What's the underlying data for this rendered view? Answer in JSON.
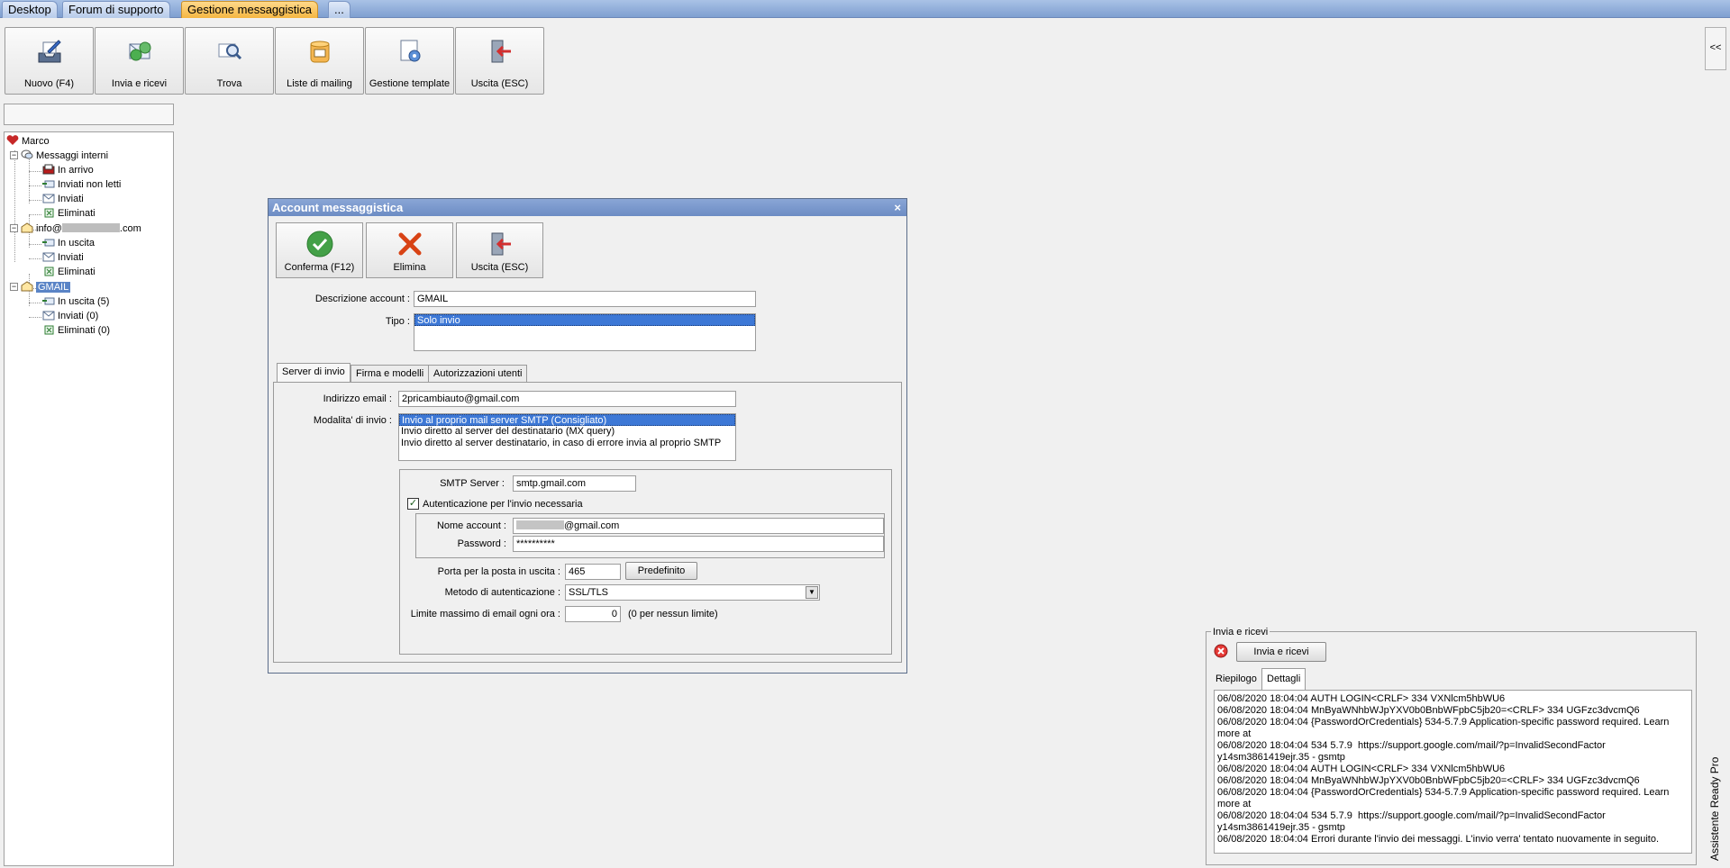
{
  "top_tabs": [
    {
      "label": "Desktop",
      "active": false
    },
    {
      "label": "Forum di supporto",
      "active": false
    },
    {
      "label": "Gestione messaggistica",
      "active": true
    },
    {
      "label": "...",
      "active": false
    }
  ],
  "toolbar": {
    "buttons": [
      {
        "label": "Nuovo (F4)",
        "icon": "new-message-icon"
      },
      {
        "label": "Invia e ricevi",
        "icon": "send-receive-icon"
      },
      {
        "label": "Trova",
        "icon": "find-icon"
      },
      {
        "label": "Liste di mailing",
        "icon": "mailing-list-icon"
      },
      {
        "label": "Gestione template",
        "icon": "template-icon"
      },
      {
        "label": "Uscita (ESC)",
        "icon": "exit-icon"
      }
    ]
  },
  "collapse_label": "<<",
  "side_panel_label": "Assistente Ready Pro",
  "tree": {
    "root": "Marco",
    "internal": {
      "label": "Messaggi interni",
      "children": [
        "In arrivo",
        "Inviati non letti",
        "Inviati",
        "Eliminati"
      ]
    },
    "info_account": {
      "label_prefix": "info@",
      "label_suffix": ".com",
      "children": [
        "In uscita",
        "Inviati",
        "Eliminati"
      ]
    },
    "gmail": {
      "label": "GMAIL",
      "children": [
        "In uscita (5)",
        "Inviati (0)",
        "Eliminati (0)"
      ]
    }
  },
  "dialog": {
    "title": "Account messaggistica",
    "close": "×",
    "buttons": [
      {
        "label": "Conferma (F12)"
      },
      {
        "label": "Elimina"
      },
      {
        "label": "Uscita (ESC)"
      }
    ],
    "descrizione_label": "Descrizione account :",
    "descrizione_value": "GMAIL",
    "tipo_label": "Tipo :",
    "tipo_options": [
      "Solo invio"
    ],
    "tabs": [
      "Server di invio",
      "Firma e modelli",
      "Autorizzazioni utenti"
    ],
    "email_label": "Indirizzo email :",
    "email_value": "2pricambiauto@gmail.com",
    "modalita_label": "Modalita' di invio :",
    "modalita_options": [
      "Invio al proprio mail server SMTP (Consigliato)",
      "Invio diretto al server del destinatario (MX query)",
      "Invio diretto al server destinatario, in caso di errore invia al proprio SMTP"
    ],
    "smtp_label": "SMTP Server :",
    "smtp_value": "smtp.gmail.com",
    "auth_checkbox_label": "Autenticazione per l'invio necessaria",
    "auth_checked": true,
    "account_label": "Nome account :",
    "account_value_suffix": "@gmail.com",
    "password_label": "Password :",
    "password_value": "**********",
    "porta_label": "Porta per la posta in uscita :",
    "porta_value": "465",
    "predefinito_label": "Predefinito",
    "metodo_label": "Metodo di autenticazione :",
    "metodo_value": "SSL/TLS",
    "limite_label": "Limite massimo di email ogni ora :",
    "limite_value": "0",
    "limite_note": "(0 per nessun limite)"
  },
  "send_receive": {
    "group_title": "Invia e ricevi",
    "button_label": "Invia e ricevi",
    "tabs": [
      "Riepilogo",
      "Dettagli"
    ],
    "active_tab": "Dettagli",
    "log": [
      "06/08/2020 18:04:04 AUTH LOGIN<CRLF> 334 VXNlcm5hbWU6",
      "06/08/2020 18:04:04 MnByaWNhbWJpYXV0b0BnbWFpbC5jb20=<CRLF> 334 UGFzc3dvcmQ6",
      "06/08/2020 18:04:04 {PasswordOrCredentials} 534-5.7.9 Application-specific password required. Learn more at",
      "06/08/2020 18:04:04 534 5.7.9  https://support.google.com/mail/?p=InvalidSecondFactor y14sm3861419ejr.35 - gsmtp",
      "06/08/2020 18:04:04 AUTH LOGIN<CRLF> 334 VXNlcm5hbWU6",
      "06/08/2020 18:04:04 MnByaWNhbWJpYXV0b0BnbWFpbC5jb20=<CRLF> 334 UGFzc3dvcmQ6",
      "06/08/2020 18:04:04 {PasswordOrCredentials} 534-5.7.9 Application-specific password required. Learn more at",
      "06/08/2020 18:04:04 534 5.7.9  https://support.google.com/mail/?p=InvalidSecondFactor y14sm3861419ejr.35 - gsmtp",
      "06/08/2020 18:04:04 Errori durante l'invio dei messaggi. L'invio verra' tentato nuovamente in seguito."
    ]
  }
}
